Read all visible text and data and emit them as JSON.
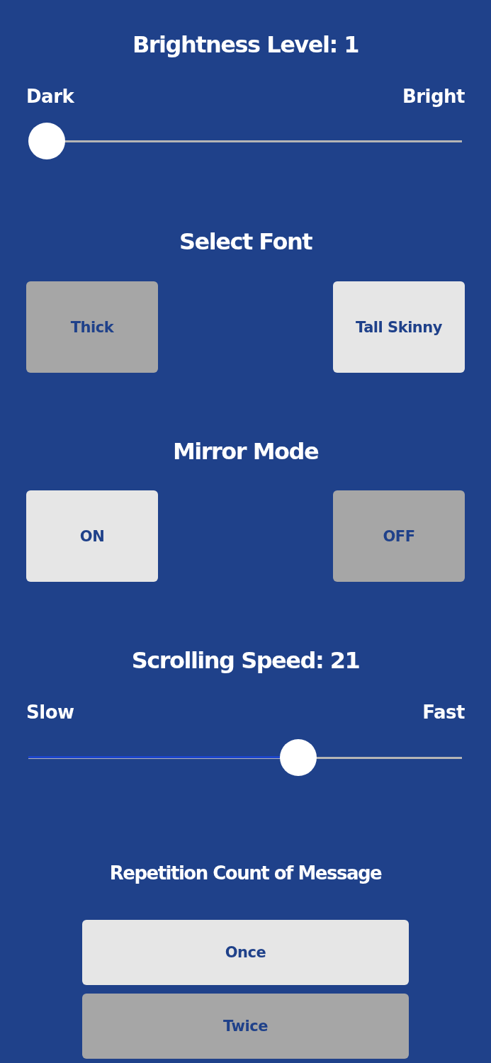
{
  "brightness": {
    "title": "Brightness Level: 1",
    "min_label": "Dark",
    "max_label": "Bright",
    "level": 0
  },
  "font": {
    "title": "Select Font",
    "options": [
      {
        "label": "Thick",
        "selected": true
      },
      {
        "label": "Tall Skinny",
        "selected": false
      }
    ]
  },
  "mirror": {
    "title": "Mirror Mode",
    "options": [
      {
        "label": "ON",
        "selected": false
      },
      {
        "label": "OFF",
        "selected": true
      }
    ]
  },
  "speed": {
    "title": "Scrolling Speed: 21",
    "min_label": "Slow",
    "max_label": "Fast",
    "level": 0.634
  },
  "repetition": {
    "title": "Repetition Count of Message",
    "options": [
      {
        "label": "Once",
        "selected": false
      },
      {
        "label": "Twice",
        "selected": true
      }
    ]
  }
}
